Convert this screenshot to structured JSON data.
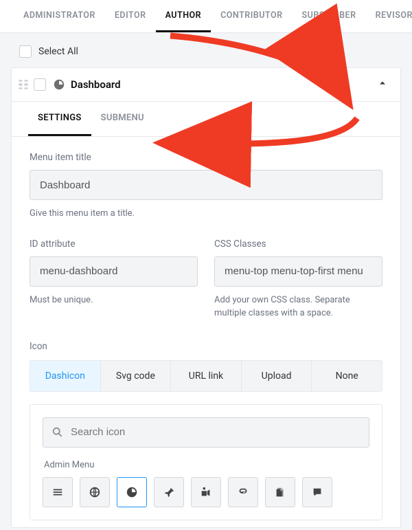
{
  "roleTabs": {
    "items": [
      "ADMINISTRATOR",
      "EDITOR",
      "AUTHOR",
      "CONTRIBUTOR",
      "SUBSCRIBER",
      "REVISOR"
    ],
    "activeIndex": 2
  },
  "selectAll": {
    "label": "Select All"
  },
  "item": {
    "title": "Dashboard"
  },
  "innerTabs": {
    "items": [
      "SETTINGS",
      "SUBMENU"
    ],
    "activeIndex": 0
  },
  "fields": {
    "title": {
      "label": "Menu item title",
      "value": "Dashboard",
      "hint": "Give this menu item a title."
    },
    "id": {
      "label": "ID attribute",
      "value": "menu-dashboard",
      "hint": "Must be unique."
    },
    "css": {
      "label": "CSS Classes",
      "value": "menu-top menu-top-first menu",
      "hint": "Add your own CSS class. Separate multiple classes with a space."
    }
  },
  "iconSection": {
    "label": "Icon",
    "tabs": [
      "Dashicon",
      "Svg code",
      "URL link",
      "Upload",
      "None"
    ],
    "activeIndex": 0,
    "search": {
      "placeholder": "Search icon"
    },
    "category": "Admin Menu",
    "icons": [
      "menu",
      "site",
      "dashboard",
      "post",
      "media",
      "link",
      "page",
      "comment"
    ],
    "activeIcon": 2
  }
}
